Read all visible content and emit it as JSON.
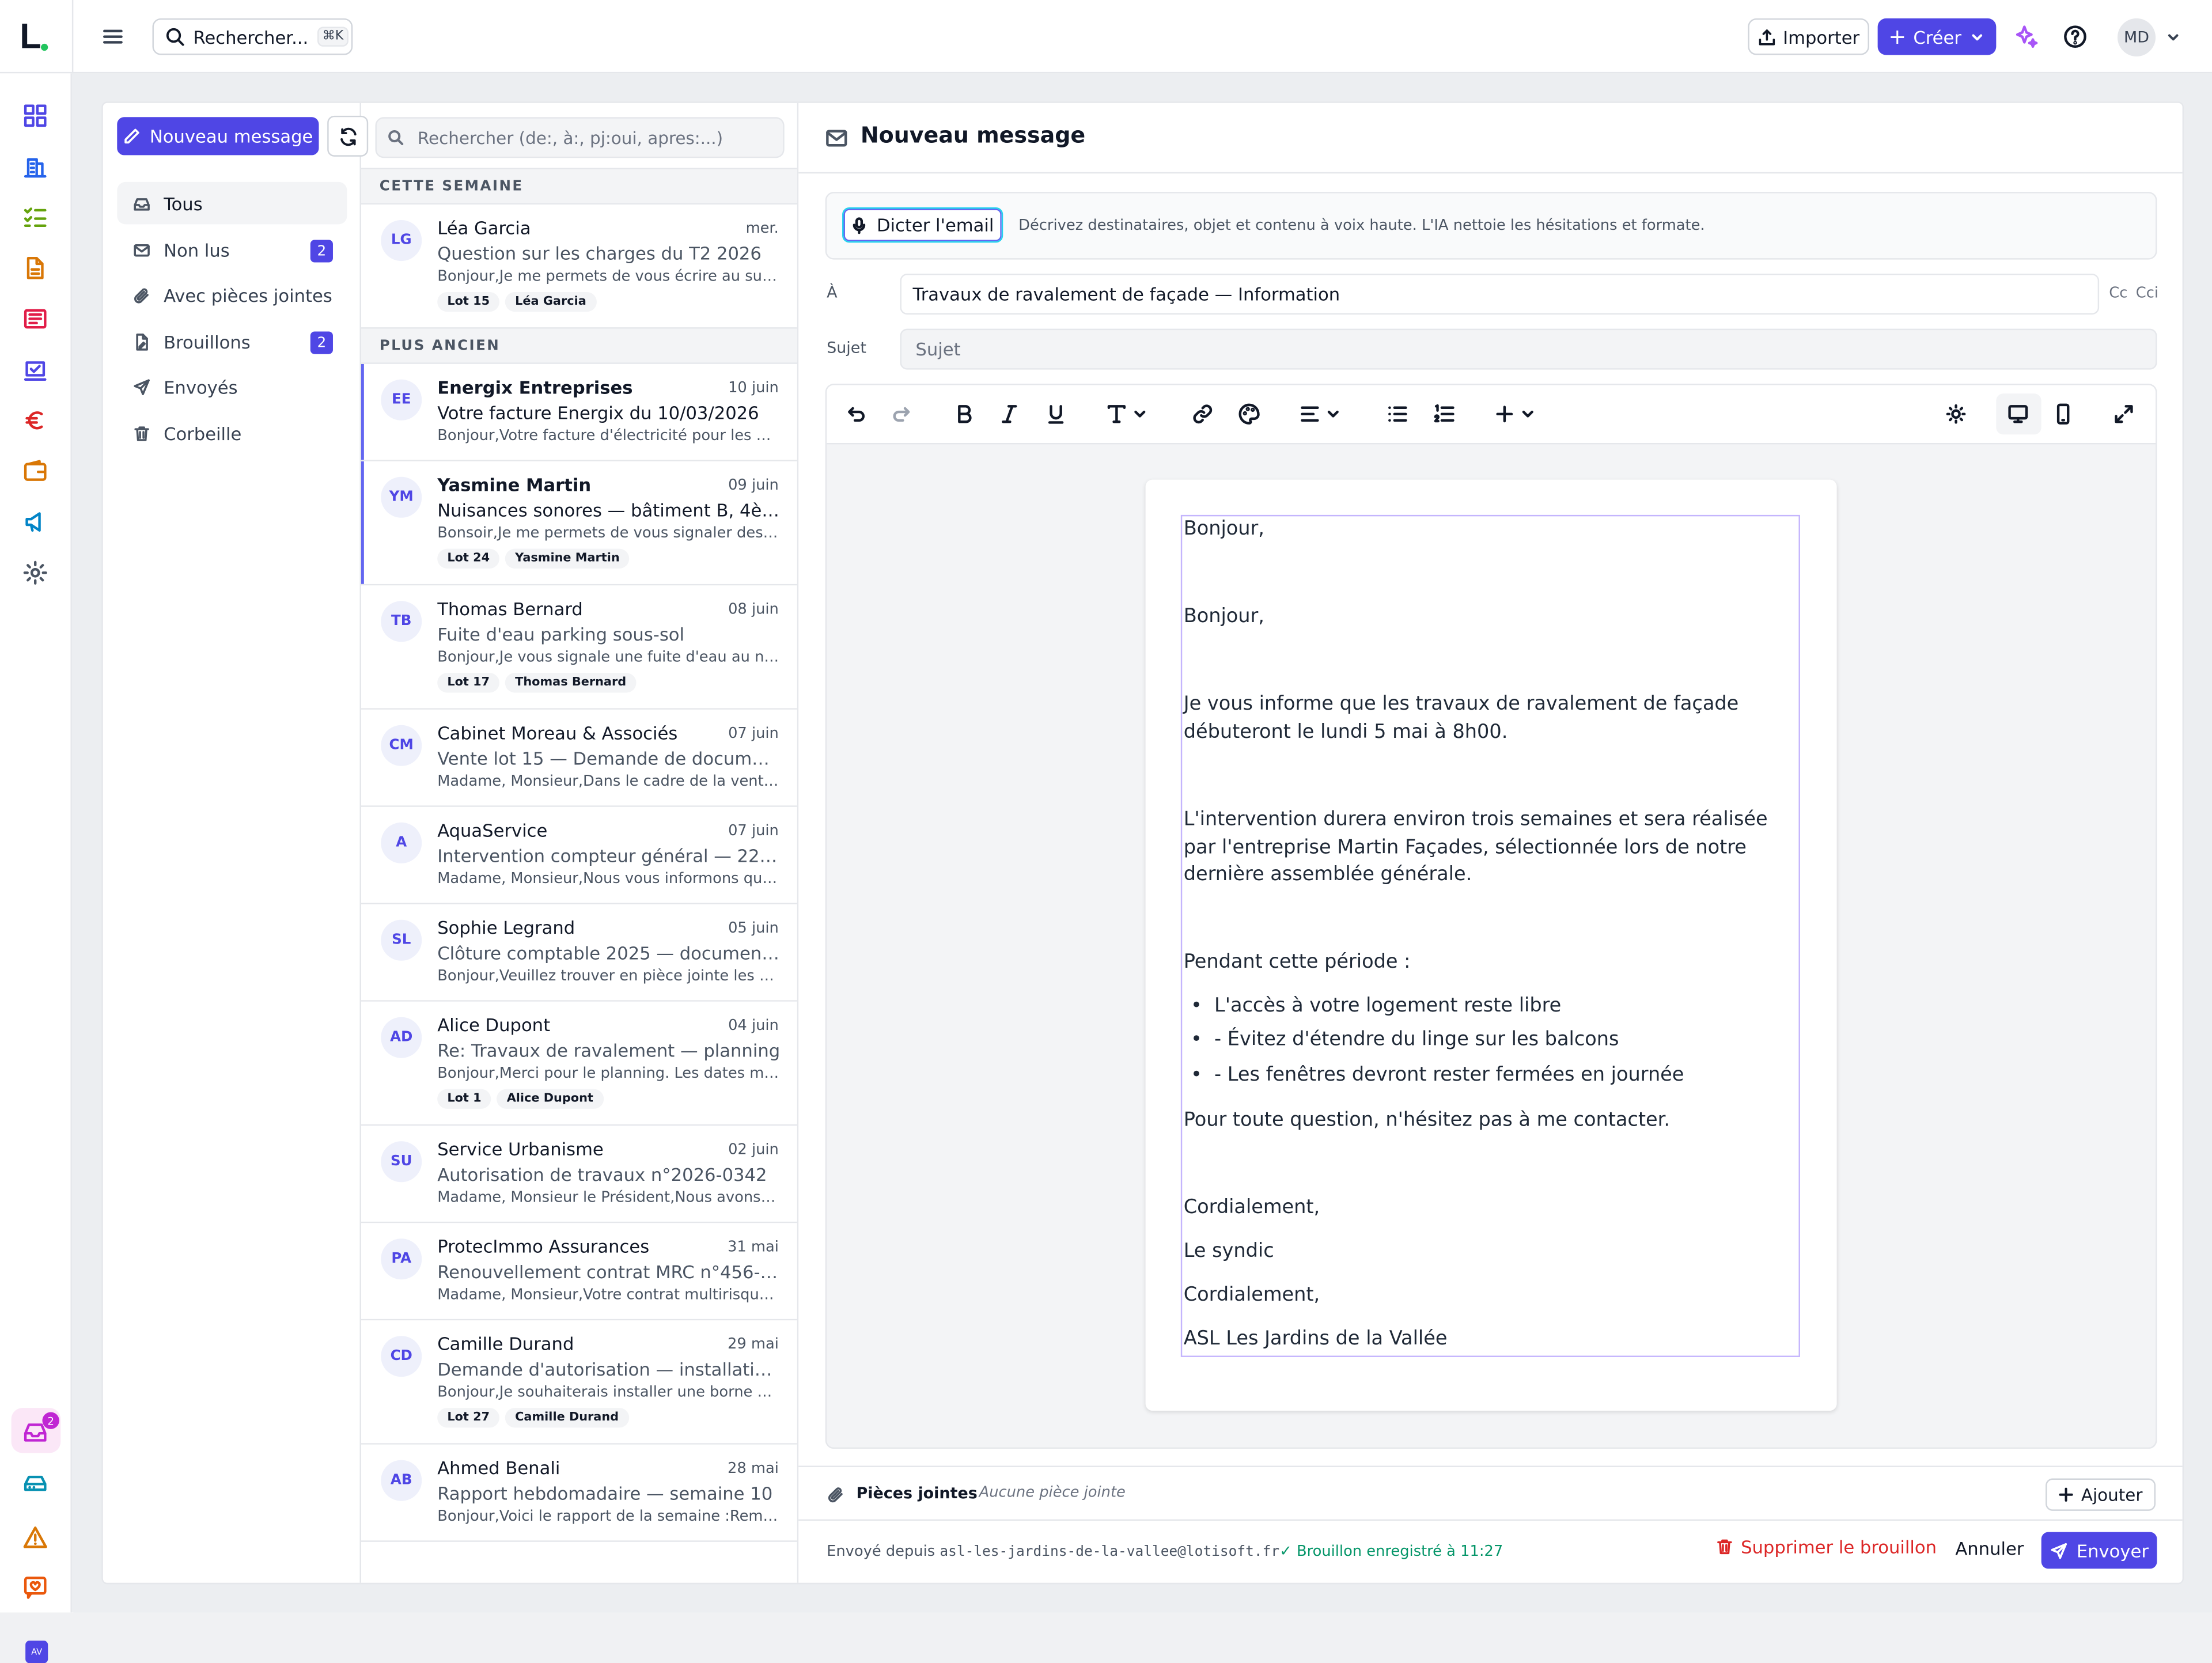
{
  "app": {
    "logo": "L."
  },
  "topbar": {
    "search_label": "Rechercher...",
    "search_shortcut": "⌘K",
    "import_label": "Importer",
    "create_label": "Créer",
    "avatar_initials": "MD"
  },
  "rail": {
    "icons": [
      "dashboard-icon",
      "building-icon",
      "checklist-icon",
      "document-icon",
      "newspaper-icon",
      "vote-icon",
      "euro-icon",
      "wallet-icon",
      "megaphone-icon",
      "settings-icon",
      "inbox-icon",
      "storage-icon",
      "warning-icon",
      "chat-heart-icon"
    ],
    "inbox_badge": "2",
    "workspace_initials": "AV"
  },
  "folders": {
    "new_message_label": "Nouveau message",
    "items": [
      {
        "label": "Tous",
        "icon": "inbox-icon",
        "badge": ""
      },
      {
        "label": "Non lus",
        "icon": "mail-icon",
        "badge": "2"
      },
      {
        "label": "Avec pièces jointes",
        "icon": "paperclip-icon",
        "badge": ""
      },
      {
        "label": "Brouillons",
        "icon": "draft-icon",
        "badge": "2"
      },
      {
        "label": "Envoyés",
        "icon": "send-icon",
        "badge": ""
      },
      {
        "label": "Corbeille",
        "icon": "trash-icon",
        "badge": ""
      }
    ]
  },
  "list": {
    "search_placeholder": "Rechercher (de:, à:, pj:oui, apres:...)",
    "section_this_week": "CETTE SEMAINE",
    "section_older": "PLUS ANCIEN",
    "this_week": [
      {
        "initials": "LG",
        "sender": "Léa Garcia",
        "date": "mer.",
        "subject": "Question sur les charges du T2 2026",
        "preview": "Bonjour,Je me permets de vous écrire au sujet des charges",
        "tags": [
          "Lot 15",
          "Léa Garcia"
        ],
        "unread": false
      }
    ],
    "older": [
      {
        "initials": "EE",
        "sender": "Energix Entreprises",
        "date": "10 juin",
        "subject": "Votre facture Energix du 10/03/2026",
        "preview": "Bonjour,Votre facture d'électricité pour les parties communes",
        "tags": [],
        "unread": true
      },
      {
        "initials": "YM",
        "sender": "Yasmine Martin",
        "date": "09 juin",
        "subject": "Nuisances sonores — bâtiment B, 4ème étage",
        "preview": "Bonsoir,Je me permets de vous signaler des nuisances",
        "tags": [
          "Lot 24",
          "Yasmine Martin"
        ],
        "unread": true
      },
      {
        "initials": "TB",
        "sender": "Thomas Bernard",
        "date": "08 juin",
        "subject": "Fuite d'eau parking sous-sol",
        "preview": "Bonjour,Je vous signale une fuite d'eau au niveau du parking",
        "tags": [
          "Lot 17",
          "Thomas Bernard"
        ],
        "unread": false
      },
      {
        "initials": "CM",
        "sender": "Cabinet Moreau & Associés",
        "date": "07 juin",
        "subject": "Vente lot 15 — Demande de documents",
        "preview": "Madame, Monsieur,Dans le cadre de la vente du lot 15",
        "tags": [],
        "unread": false
      },
      {
        "initials": "A",
        "sender": "AquaService",
        "date": "07 juin",
        "subject": "Intervention compteur général — 22 mars",
        "preview": "Madame, Monsieur,Nous vous informons qu'une intervention",
        "tags": [],
        "unread": false
      },
      {
        "initials": "SL",
        "sender": "Sophie Legrand",
        "date": "05 juin",
        "subject": "Clôture comptable 2025 — documents à valider",
        "preview": "Bonjour,Veuillez trouver en pièce jointe les documents",
        "tags": [],
        "unread": false
      },
      {
        "initials": "AD",
        "sender": "Alice Dupont",
        "date": "04 juin",
        "subject": "Re: Travaux de ravalement — planning",
        "preview": "Bonjour,Merci pour le planning. Les dates me conviennent",
        "tags": [
          "Lot 1",
          "Alice Dupont"
        ],
        "unread": false
      },
      {
        "initials": "SU",
        "sender": "Service Urbanisme",
        "date": "02 juin",
        "subject": "Autorisation de travaux n°2026-0342",
        "preview": "Madame, Monsieur le Président,Nous avons le plaisir",
        "tags": [],
        "unread": false
      },
      {
        "initials": "PA",
        "sender": "ProtecImmo Assurances",
        "date": "31 mai",
        "subject": "Renouvellement contrat MRC n°456-789-012",
        "preview": "Madame, Monsieur,Votre contrat multirisque copropriété",
        "tags": [],
        "unread": false
      },
      {
        "initials": "CD",
        "sender": "Camille Durand",
        "date": "29 mai",
        "subject": "Demande d'autorisation — installation borne",
        "preview": "Bonjour,Je souhaiterais installer une borne de recharge",
        "tags": [
          "Lot 27",
          "Camille Durand"
        ],
        "unread": false
      },
      {
        "initials": "AB",
        "sender": "Ahmed Benali",
        "date": "28 mai",
        "subject": "Rapport hebdomadaire — semaine 10",
        "preview": "Bonjour,Voici le rapport de la semaine :Remplacement",
        "tags": [],
        "unread": false
      }
    ]
  },
  "composer": {
    "title": "Nouveau message",
    "dictate_label": "Dicter l'email",
    "dictate_help": "Décrivez destinataires, objet et contenu à voix haute. L'IA nettoie les hésitations et formate.",
    "to_label": "À",
    "to_value": "Travaux de ravalement de façade — Information",
    "cc_label": "Cc",
    "cci_label": "Cci",
    "subject_label": "Sujet",
    "subject_placeholder": "Sujet",
    "body": {
      "greeting1": "Bonjour,",
      "greeting2": "Bonjour,",
      "p1": "Je vous informe que les travaux de ravalement de façade débuteront le lundi 5 mai à 8h00.",
      "p2": "L'intervention durera environ trois semaines et sera réalisée par l'entreprise Martin Façades, sélectionnée lors de notre dernière assemblée générale.",
      "p3": "Pendant cette période :",
      "bullets": [
        "L'accès à votre logement reste libre",
        "- Évitez d'étendre du linge sur les balcons",
        "- Les fenêtres devront rester fermées en journée"
      ],
      "p4": "Pour toute question, n'hésitez pas à me contacter.",
      "closing1": "Cordialement,",
      "sig1": "Le syndic",
      "closing2": "Cordialement,",
      "sig2": "ASL Les Jardins de la Vallée"
    },
    "attachments_label": "Pièces jointes",
    "attachments_none": "Aucune pièce jointe",
    "add_label": "Ajouter",
    "sent_from_prefix": "Envoyé depuis",
    "sent_from_address": "asl-les-jardins-de-la-vallee@lotisoft.fr",
    "draft_saved": "✓ Brouillon enregistré à 11:27",
    "delete_draft_label": "Supprimer le brouillon",
    "cancel_label": "Annuler",
    "send_label": "Envoyer"
  },
  "colors": {
    "accent": "#4f46e5",
    "danger": "#dc2626",
    "success": "#059669",
    "badge": "#c026d3"
  }
}
